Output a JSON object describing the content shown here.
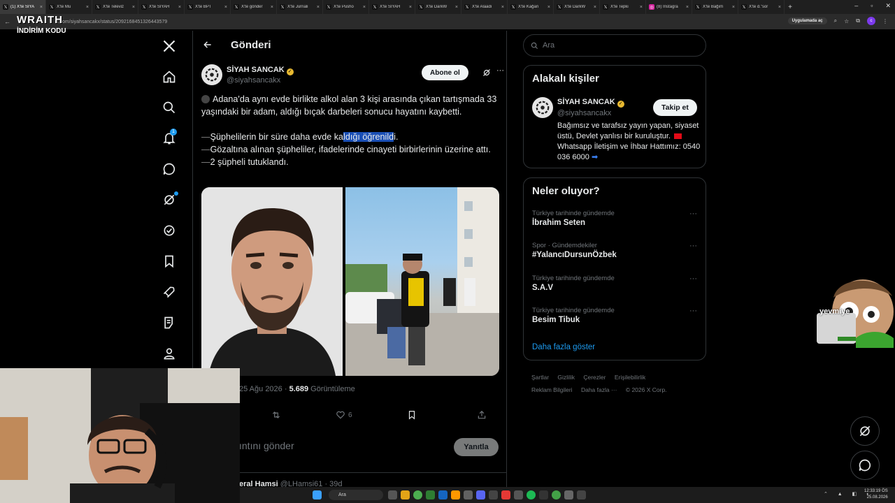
{
  "browser": {
    "tabs": [
      {
        "label": "(1) X'te SİYA",
        "icon": "x-logo",
        "active": true
      },
      {
        "label": "X'te Mu",
        "icon": "x-logo"
      },
      {
        "label": "X'te Televiz",
        "icon": "x-logo"
      },
      {
        "label": "X'te SİYAH",
        "icon": "x-logo"
      },
      {
        "label": "X'te BPT",
        "icon": "x-logo"
      },
      {
        "label": "X'te gönder",
        "icon": "x-logo"
      },
      {
        "label": "X'te Jurnali",
        "icon": "x-logo"
      },
      {
        "label": "X'te Pusho",
        "icon": "x-logo"
      },
      {
        "label": "X'te SİYAH",
        "icon": "x-logo"
      },
      {
        "label": "X'te DarkW",
        "icon": "x-logo"
      },
      {
        "label": "X'te Alaadi",
        "icon": "x-logo"
      },
      {
        "label": "X'te Kağan",
        "icon": "x-logo"
      },
      {
        "label": "X'te DarkW",
        "icon": "x-logo"
      },
      {
        "label": "X'te Tepki",
        "icon": "x-logo"
      },
      {
        "label": "(8) Instagra",
        "icon": "instagram"
      },
      {
        "label": "X'te Bağım",
        "icon": "x-logo"
      },
      {
        "label": "X'te d.\"sor",
        "icon": "x-logo"
      }
    ],
    "url": "x.com/siyahsancakx/status/2092168451326443579",
    "app_open_label": "Uygulamada aç"
  },
  "overlay": {
    "wraith": "WRAITH",
    "promo": "İNDİRİM KODU"
  },
  "nav": {
    "items": [
      {
        "name": "x-logo",
        "icon": "x"
      },
      {
        "name": "home",
        "icon": "home"
      },
      {
        "name": "explore",
        "icon": "search"
      },
      {
        "name": "notifications",
        "icon": "bell",
        "badge": "1"
      },
      {
        "name": "messages",
        "icon": "message"
      },
      {
        "name": "grok",
        "icon": "grok",
        "dot": true
      },
      {
        "name": "verified",
        "icon": "verified"
      },
      {
        "name": "bookmarks",
        "icon": "bookmark"
      },
      {
        "name": "jobs",
        "icon": "rocket"
      },
      {
        "name": "communities",
        "icon": "list"
      },
      {
        "name": "profile",
        "icon": "person"
      }
    ]
  },
  "header": {
    "title": "Gönderi"
  },
  "post": {
    "author_name": "SİYAH SANCAK",
    "author_handle": "@siyahsancakx",
    "subscribe_label": "Abone ol",
    "line1": "Adana'da aynı evde birlikte alkol alan 3 kişi arasında çıkan tartışmada 33 yaşındaki bir adam, aldığı bıçak darbeleri sonucu hayatını kaybetti.",
    "line2_pre": "Şüphelilerin bir süre daha evde ka",
    "line2_hl": "ldığı öğrenild",
    "line2_post": "i.",
    "line3": "Gözaltına alınan şüpheliler, ifadelerinde cinayeti birbirlerinin üzerine attı.",
    "line4": "2 şüpheli tutuklandı.",
    "date": "25 Ağu 2026",
    "views_count": "5.689",
    "views_label": "Görüntüleme",
    "likes": "6",
    "reply_placeholder": "ıntını gönder",
    "reply_button": "Yanıtla",
    "next_reply_name": "eral Hamsi",
    "next_reply_meta": "@LHamsi61 · 39d"
  },
  "sidebar": {
    "search_placeholder": "Ara",
    "related_title": "Alakalı kişiler",
    "related": {
      "name": "SİYAH SANCAK",
      "handle": "@siyahsancakx",
      "follow_label": "Takip et",
      "bio_1": "Bağımsız ve tarafsız yayın yapan, siyaset üstü, Devlet yanlısı bir kuruluştur.",
      "bio_2": "Whatsapp İletişim ve İhbar Hattımız: 0540 036 6000"
    },
    "trends_title": "Neler oluyor?",
    "trends": [
      {
        "category": "Türkiye tarihinde gündemde",
        "name": "İbrahim Seten"
      },
      {
        "category": "Spor · Gündemdekiler",
        "name": "#YalancıDursunÖzbek"
      },
      {
        "category": "Türkiye tarihinde gündemde",
        "name": "S.A.V"
      },
      {
        "category": "Türkiye tarihinde gündemde",
        "name": "Besim Tibuk"
      }
    ],
    "show_more": "Daha fazla göster",
    "footer": [
      "Şartlar",
      "Gizlilik",
      "Çerezler",
      "Erişilebilirlik",
      "Reklam Bilgileri",
      "Daha fazla ···",
      "© 2026 X Corp."
    ]
  },
  "sticker": {
    "label": "yevmiye"
  },
  "taskbar": {
    "search": "Ara",
    "time": "12:33:19 ÖS",
    "date": "25.08.2026"
  }
}
